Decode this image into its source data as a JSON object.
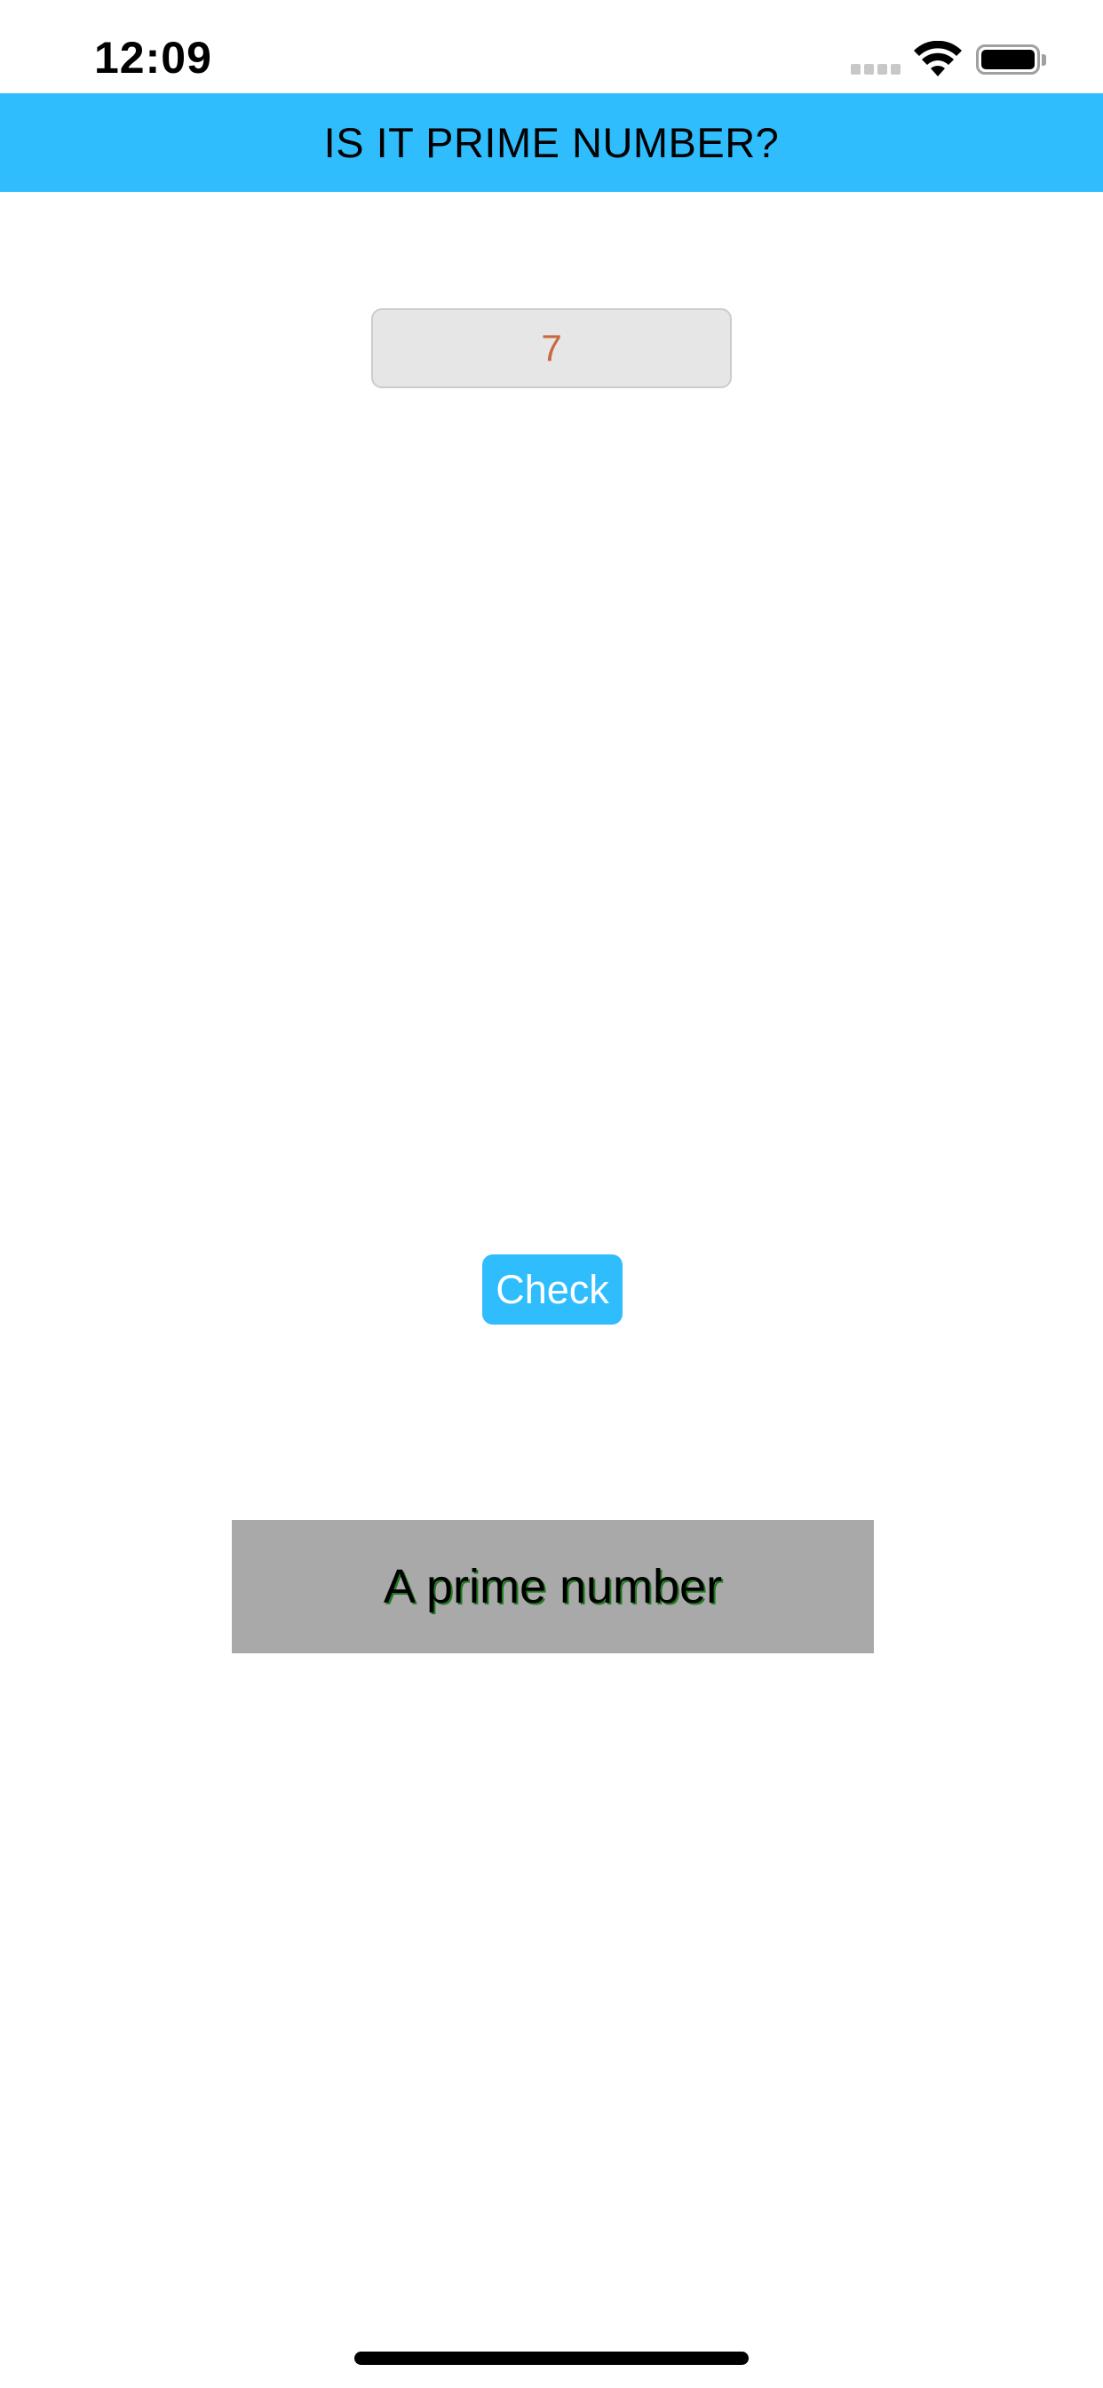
{
  "status_bar": {
    "time": "12:09",
    "icons": [
      "cellular-signal-icon",
      "wifi-icon",
      "battery-icon"
    ]
  },
  "header": {
    "title": "IS IT PRIME NUMBER?",
    "background_color": "#2fbdfd"
  },
  "number_input": {
    "value": "7",
    "text_color": "#c9683e"
  },
  "check_button": {
    "label": "Check",
    "color": "#2fbdfd"
  },
  "result": {
    "text": "A prime number",
    "background_color": "#a9a9a9"
  }
}
